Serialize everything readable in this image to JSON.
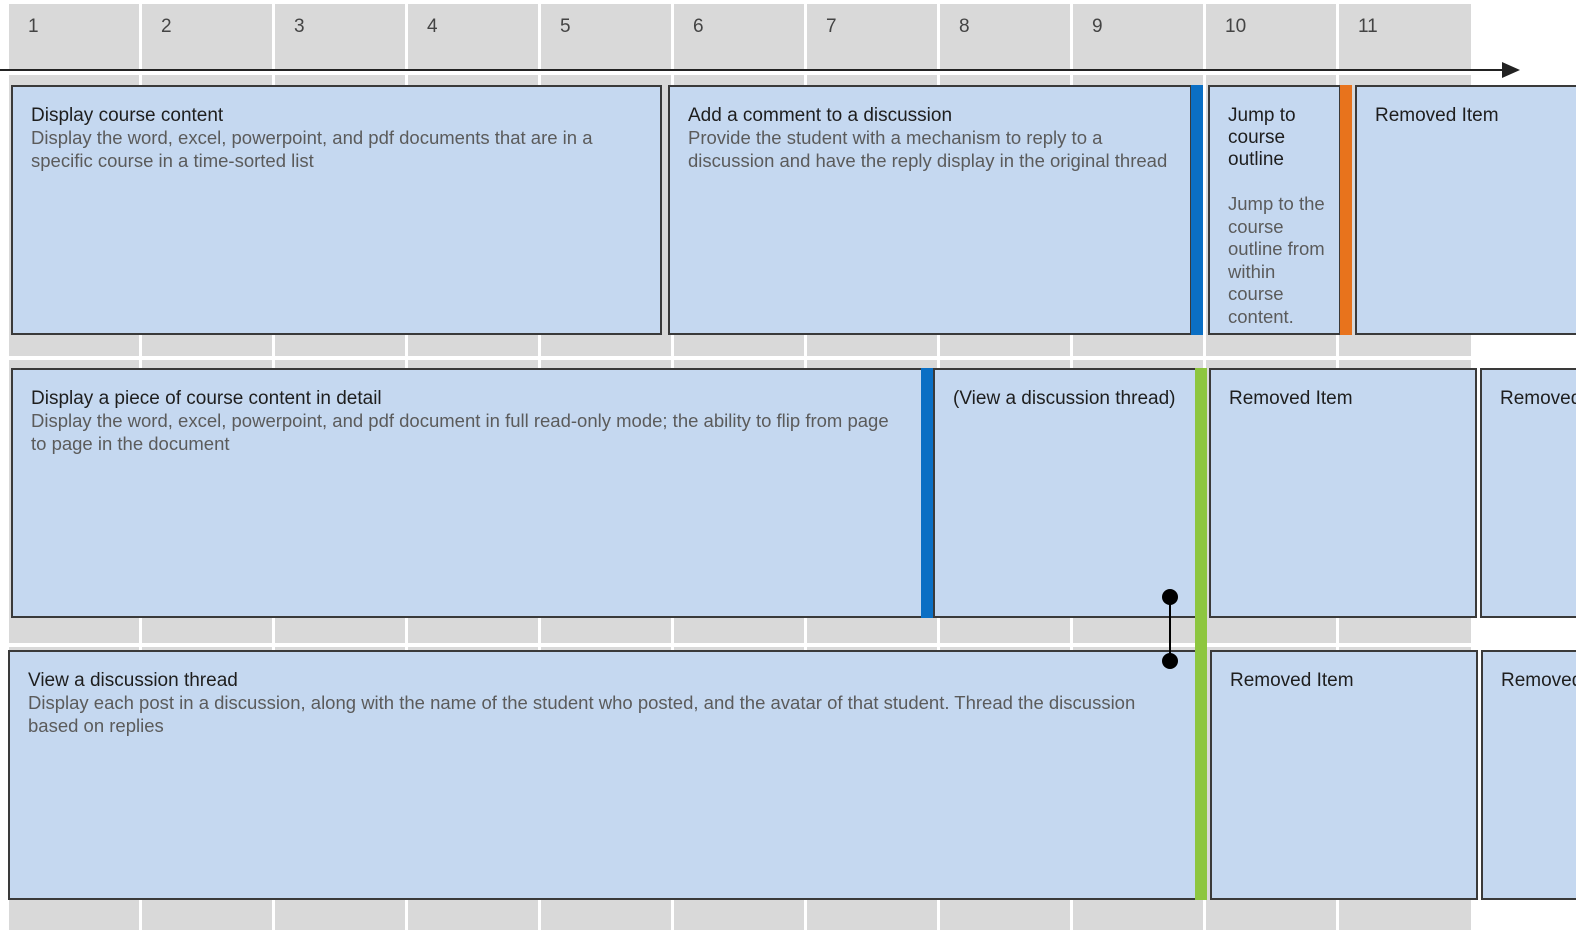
{
  "timeline": {
    "columns": [
      "1",
      "2",
      "3",
      "4",
      "5",
      "6",
      "7",
      "8",
      "9",
      "10",
      "11"
    ]
  },
  "rows": [
    {
      "cards": [
        {
          "title": "Display course content",
          "description": "Display the word, excel, powerpoint, and pdf documents that are in a specific course in a time-sorted list"
        },
        {
          "title": "Add a comment to a discussion",
          "description": "Provide the student with a mechanism to reply to a discussion and have the reply display in the original thread"
        },
        {
          "title": "Jump to course outline",
          "description": "Jump to the course outline from within course content."
        },
        {
          "title": "Removed Item"
        }
      ]
    },
    {
      "cards": [
        {
          "title": "Display a piece of course content in detail",
          "description": "Display the word, excel, powerpoint, and pdf document in full read-only mode; the ability to flip from page to page in the document"
        },
        {
          "title": "(View a discussion thread)"
        },
        {
          "title": "Removed Item"
        },
        {
          "title": "Removed Item"
        }
      ]
    },
    {
      "cards": [
        {
          "title": "View a discussion thread",
          "description": "Display each post in a discussion, along with the name of the student who posted, and the avatar of that student. Thread the discussion based on replies"
        },
        {
          "title": "Removed Item"
        },
        {
          "title": "Removed Item"
        }
      ]
    }
  ],
  "colors": {
    "card_fill": "#c5d8f0",
    "lane": "#d9d9d9",
    "marker_blue": "#0b6fc4",
    "marker_orange": "#e8731c",
    "marker_green": "#8dc63f"
  }
}
